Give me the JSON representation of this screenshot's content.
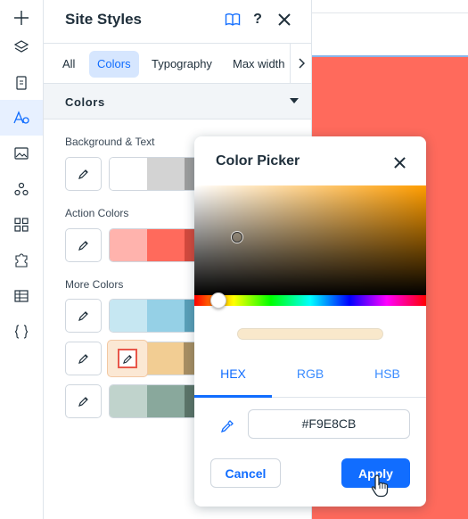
{
  "panel": {
    "title": "Site Styles",
    "help_label": "?",
    "tabs": [
      {
        "label": "All"
      },
      {
        "label": "Colors",
        "active": true
      },
      {
        "label": "Typography"
      },
      {
        "label": "Max width"
      }
    ],
    "section_title": "Colors",
    "groups": [
      {
        "label": "Background & Text",
        "swatches": [
          "#ffffff",
          "#d3d3d3",
          "#9d9d9d"
        ]
      },
      {
        "label": "Action Colors",
        "swatches": [
          "#ffb3ad",
          "#ff6a5c",
          "#d44a3e"
        ]
      },
      {
        "label": "More Colors",
        "rows": [
          [
            "#c6e7f2",
            "#95d0e6",
            "#5aa0b9"
          ],
          [
            "#f9e8cb",
            "#f2cd93",
            "#a98f63"
          ],
          [
            "#c0d3cc",
            "#89a89c",
            "#5c7569"
          ]
        ]
      }
    ]
  },
  "rail": {
    "icons": [
      "add-icon",
      "layers-icon",
      "pages-icon",
      "site-styles-icon",
      "media-icon",
      "apps-icon",
      "blocks-icon",
      "puzzle-icon",
      "table-icon",
      "code-icon"
    ],
    "active": "site-styles-icon"
  },
  "picker": {
    "title": "Color Picker",
    "tabs": [
      {
        "label": "HEX",
        "active": true
      },
      {
        "label": "RGB"
      },
      {
        "label": "HSB"
      }
    ],
    "hex_value": "#F9E8CB",
    "cancel_label": "Cancel",
    "apply_label": "Apply",
    "preview_color": "#F9E8CB"
  },
  "colors": {
    "accent": "#116dff",
    "canvas": "#ff6a5c"
  }
}
